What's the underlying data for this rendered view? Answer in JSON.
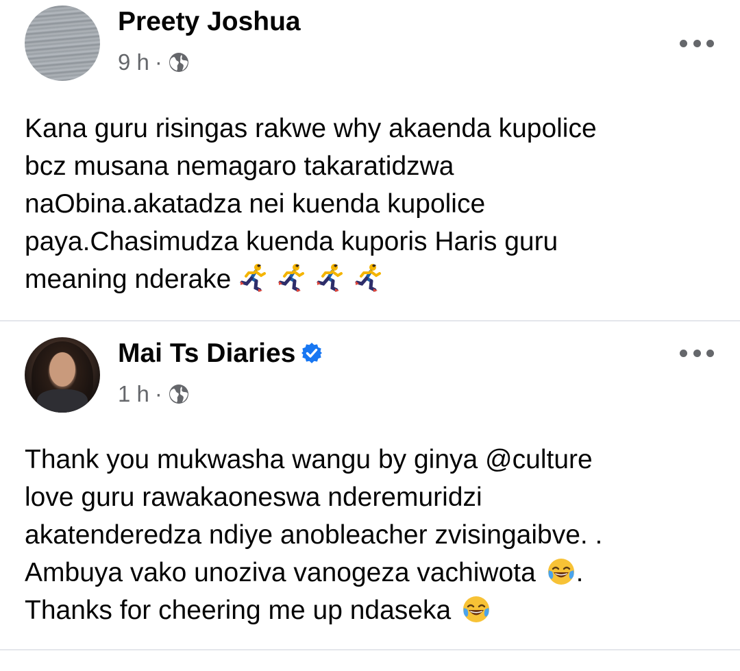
{
  "posts": [
    {
      "author": "Preety Joshua",
      "time": "9 h",
      "separator": "·",
      "privacy_icon": "globe-icon",
      "menu_icon": "more-options-icon",
      "lines": [
        "Kana guru risingas rakwe why akaenda kupolice",
        "bcz musana nemagaro takaratidzwa",
        "naObina.akatadza nei kuenda kupolice",
        "paya.Chasimudza kuenda kuporis Haris guru",
        "meaning nderake"
      ],
      "trailing_emoji": "running-man-emoji",
      "trailing_emoji_count": 4
    },
    {
      "author": "Mai Ts Diaries",
      "verified": true,
      "time": "1 h",
      "separator": "·",
      "privacy_icon": "globe-icon",
      "menu_icon": "more-options-icon",
      "lines": [
        "Thank you mukwasha wangu by ginya @culture",
        "love guru rawakaoneswa nderemuridzi",
        "akatenderedza ndiye anobleacher zvisingaibve. .",
        "Ambuya vako unoziva vanogeza vachiwota",
        "Thanks for cheering me up ndaseka"
      ],
      "line4_suffix": ".",
      "emoji": "laughing-crying-emoji"
    }
  ],
  "colors": {
    "text": "#050505",
    "meta": "#65676b",
    "divider": "#e4e6eb",
    "verified": "#1877f2"
  }
}
